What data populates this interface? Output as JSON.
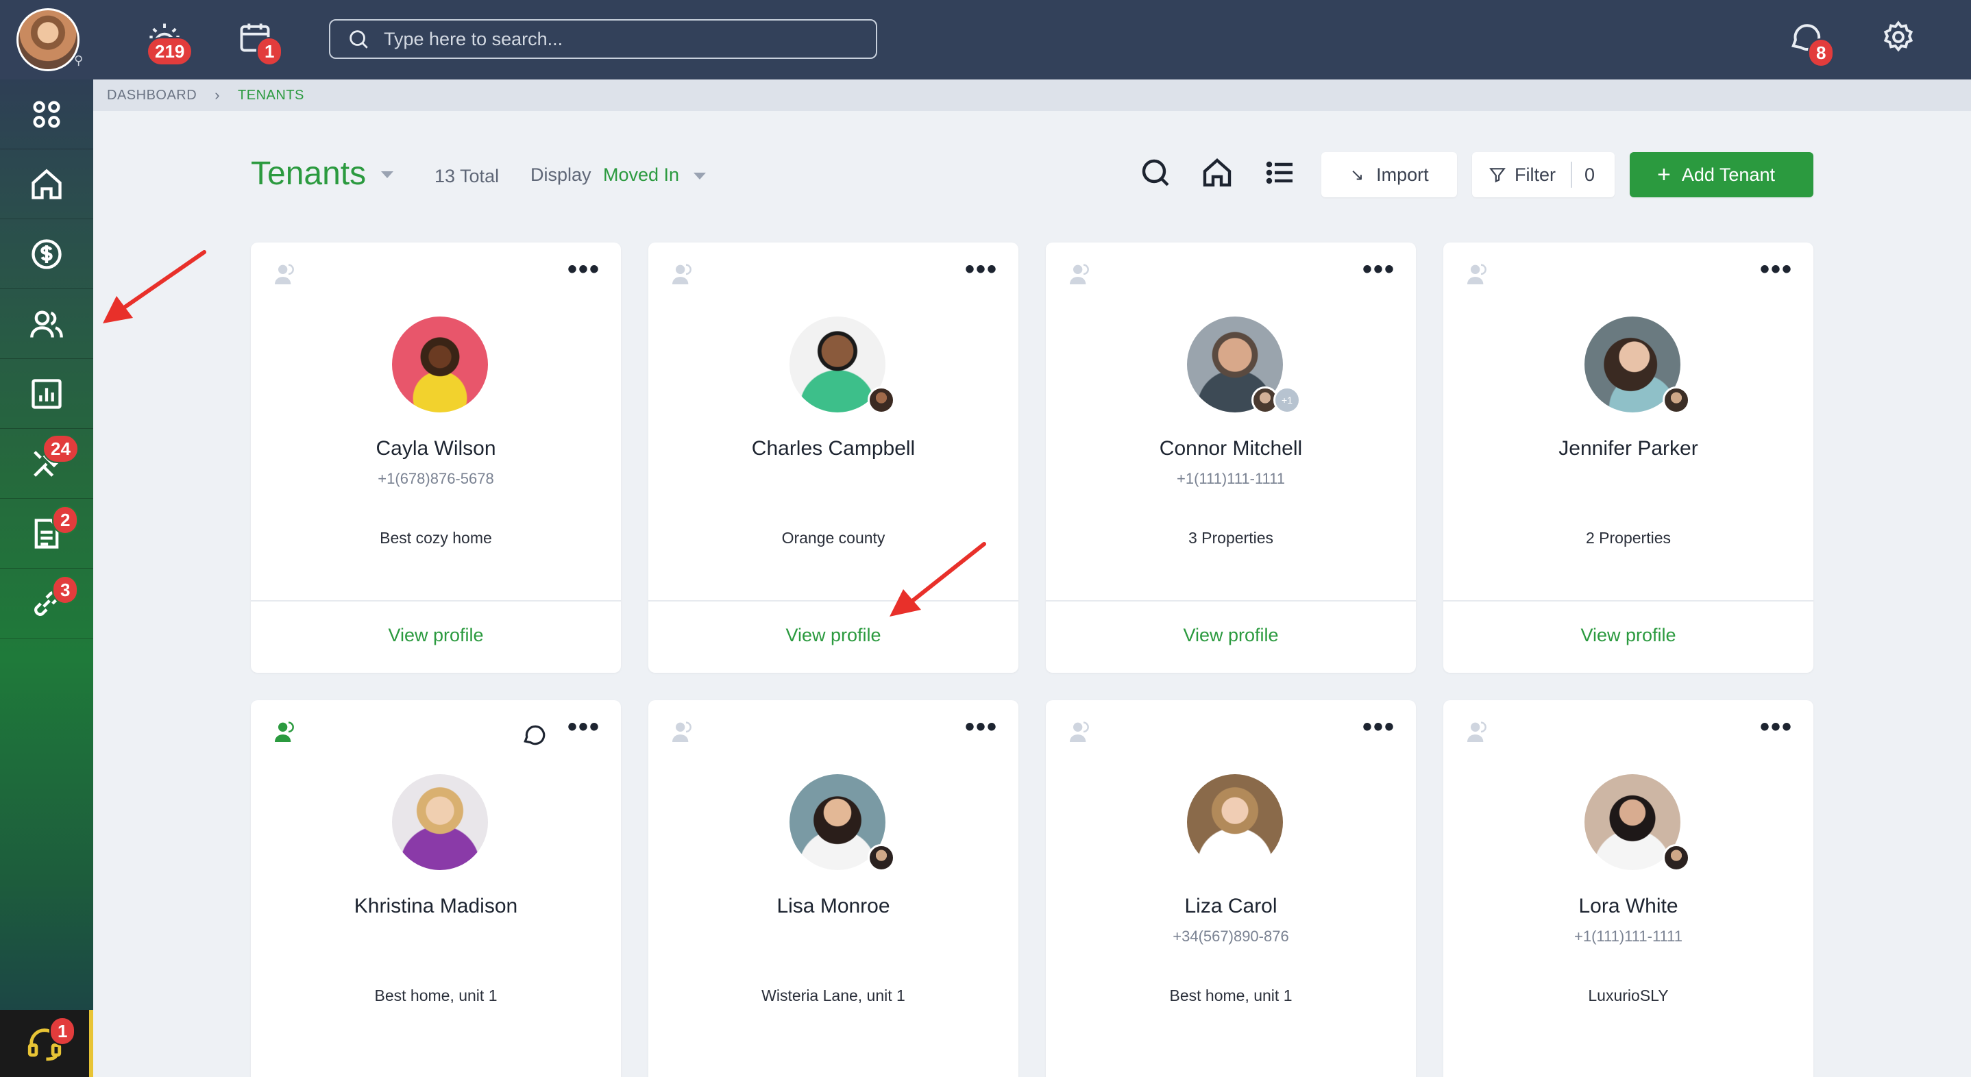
{
  "topbar": {
    "search_placeholder": "Type here to search...",
    "alarm_count": "219",
    "calendar_count": "1",
    "chat_count": "8"
  },
  "sidebar": {
    "maintenance_count": "24",
    "documents_count": "2",
    "links_count": "3",
    "support_count": "1"
  },
  "breadcrumb": {
    "root": "DASHBOARD",
    "current": "TENANTS"
  },
  "header": {
    "title": "Tenants",
    "total": "13 Total",
    "display_label": "Display",
    "display_value": "Moved In",
    "import_label": "Import",
    "filter_label": "Filter",
    "filter_count": "0",
    "add_label": "Add Tenant"
  },
  "tenants": [
    {
      "name": "Cayla Wilson",
      "phone": "+1(678)876-5678",
      "property": "Best cozy home",
      "view": "View profile"
    },
    {
      "name": "Charles Campbell",
      "phone": "",
      "property": "Orange county",
      "view": "View profile"
    },
    {
      "name": "Connor Mitchell",
      "phone": "+1(111)111-1111",
      "property": "3 Properties",
      "view": "View profile",
      "extra": "+1"
    },
    {
      "name": "Jennifer Parker",
      "phone": "",
      "property": "2 Properties",
      "view": "View profile"
    },
    {
      "name": "Khristina Madison",
      "phone": "",
      "property": "Best home, unit 1"
    },
    {
      "name": "Lisa Monroe",
      "phone": "",
      "property": "Wisteria Lane, unit 1"
    },
    {
      "name": "Liza Carol",
      "phone": "+34(567)890-876",
      "property": "Best home, unit 1"
    },
    {
      "name": "Lora White",
      "phone": "+1(111)111-1111",
      "property": "LuxurioSLY"
    }
  ],
  "colors": {
    "brand_green": "#2b9a3f",
    "topbar": "#33415a",
    "badge_red": "#e23c3c",
    "annotation_arrow": "#e8302a"
  }
}
